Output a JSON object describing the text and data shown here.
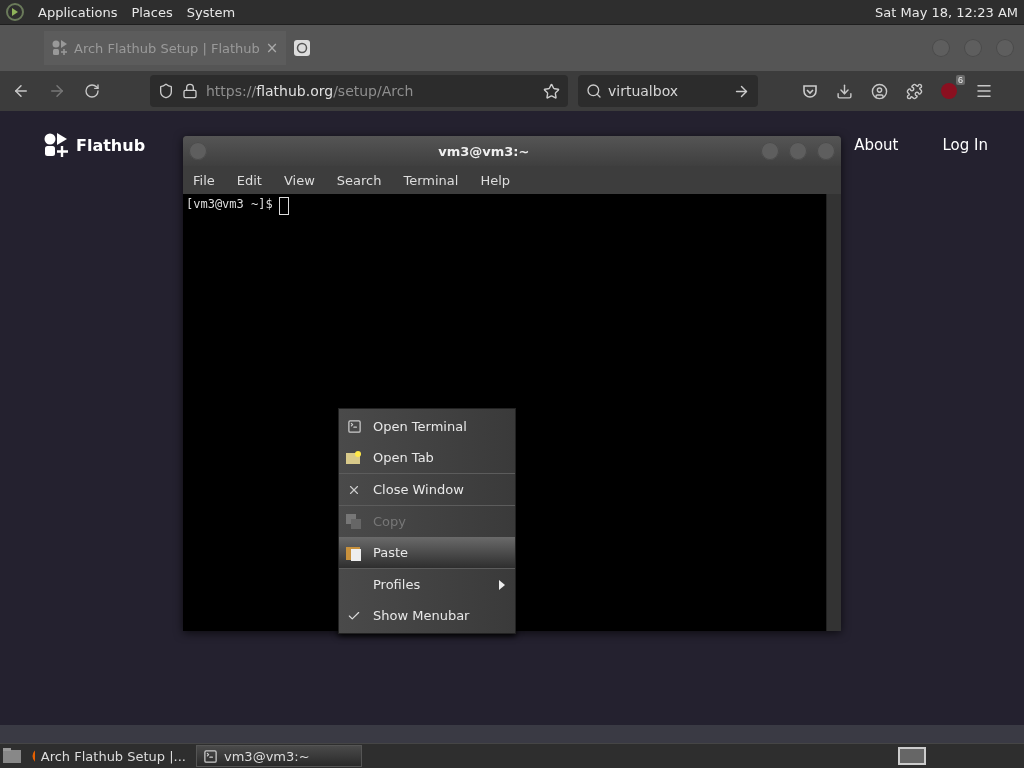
{
  "top_panel": {
    "menus": [
      "Applications",
      "Places",
      "System"
    ],
    "clock": "Sat May 18, 12:23 AM"
  },
  "browser": {
    "tabs": [
      {
        "title": "Arch Flathub Setup | Flathub",
        "close": "×"
      }
    ],
    "url": {
      "scheme": "https://",
      "host": "flathub.org",
      "path": "/setup/Arch"
    },
    "search": {
      "value": "virtualbox"
    },
    "extension_badge": "6"
  },
  "page": {
    "brand": "Flathub",
    "nav": [
      "About",
      "Log In"
    ]
  },
  "terminal": {
    "title": "vm3@vm3:~",
    "menus": [
      "File",
      "Edit",
      "View",
      "Search",
      "Terminal",
      "Help"
    ],
    "prompt": "[vm3@vm3 ~]$"
  },
  "context_menu": {
    "items": [
      {
        "kind": "item",
        "label": "Open Terminal",
        "disabled": false,
        "selected": false
      },
      {
        "kind": "item",
        "label": "Open Tab",
        "disabled": false,
        "selected": false
      },
      {
        "kind": "separator"
      },
      {
        "kind": "item",
        "label": "Close Window",
        "disabled": false,
        "selected": false
      },
      {
        "kind": "separator"
      },
      {
        "kind": "item",
        "label": "Copy",
        "disabled": true,
        "selected": false
      },
      {
        "kind": "item",
        "label": "Paste",
        "disabled": false,
        "selected": true
      },
      {
        "kind": "separator"
      },
      {
        "kind": "submenu",
        "label": "Profiles",
        "disabled": false,
        "selected": false
      },
      {
        "kind": "check",
        "label": "Show Menubar",
        "checked": true,
        "disabled": false,
        "selected": false
      }
    ]
  },
  "taskbar": {
    "tasks": [
      {
        "title": "Arch Flathub Setup |...",
        "selected": false
      },
      {
        "title": "vm3@vm3:~",
        "selected": true
      }
    ]
  }
}
